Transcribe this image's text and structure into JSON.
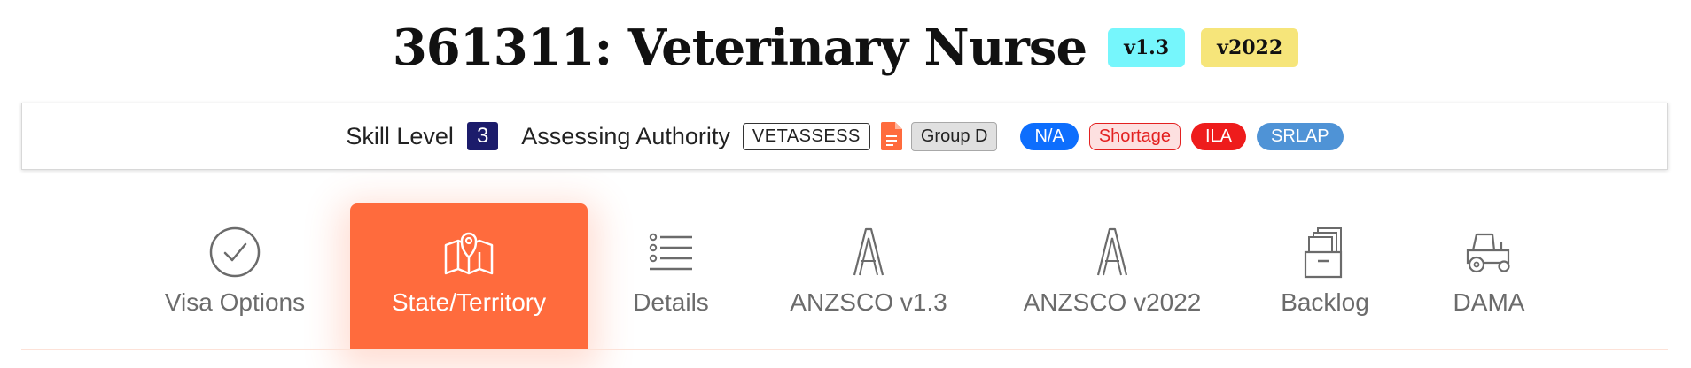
{
  "header": {
    "title": "361311: Veterinary Nurse",
    "version_badges": [
      "v1.3",
      "v2022"
    ]
  },
  "info": {
    "skill_level_label": "Skill Level",
    "skill_level_value": "3",
    "assessing_authority_label": "Assessing Authority",
    "assessing_authority_value": "VETASSESS",
    "doc_icon": "document-icon",
    "group": "Group D",
    "tags": [
      "N/A",
      "Shortage",
      "ILA",
      "SRLAP"
    ]
  },
  "tabs": [
    {
      "label": "Visa Options",
      "icon": "check-circle-icon",
      "active": false
    },
    {
      "label": "State/Territory",
      "icon": "map-pin-icon",
      "active": true
    },
    {
      "label": "Details",
      "icon": "list-icon",
      "active": false
    },
    {
      "label": "ANZSCO v1.3",
      "icon": "letter-a-icon",
      "active": false
    },
    {
      "label": "ANZSCO v2022",
      "icon": "letter-a-icon",
      "active": false
    },
    {
      "label": "Backlog",
      "icon": "archive-box-icon",
      "active": false
    },
    {
      "label": "DAMA",
      "icon": "tractor-icon",
      "active": false
    }
  ],
  "colors": {
    "active_tab": "#ff6b3d",
    "badge_v13": "#76f6fc",
    "badge_v2022": "#f6e57a",
    "skill_box": "#1c1c6b"
  }
}
